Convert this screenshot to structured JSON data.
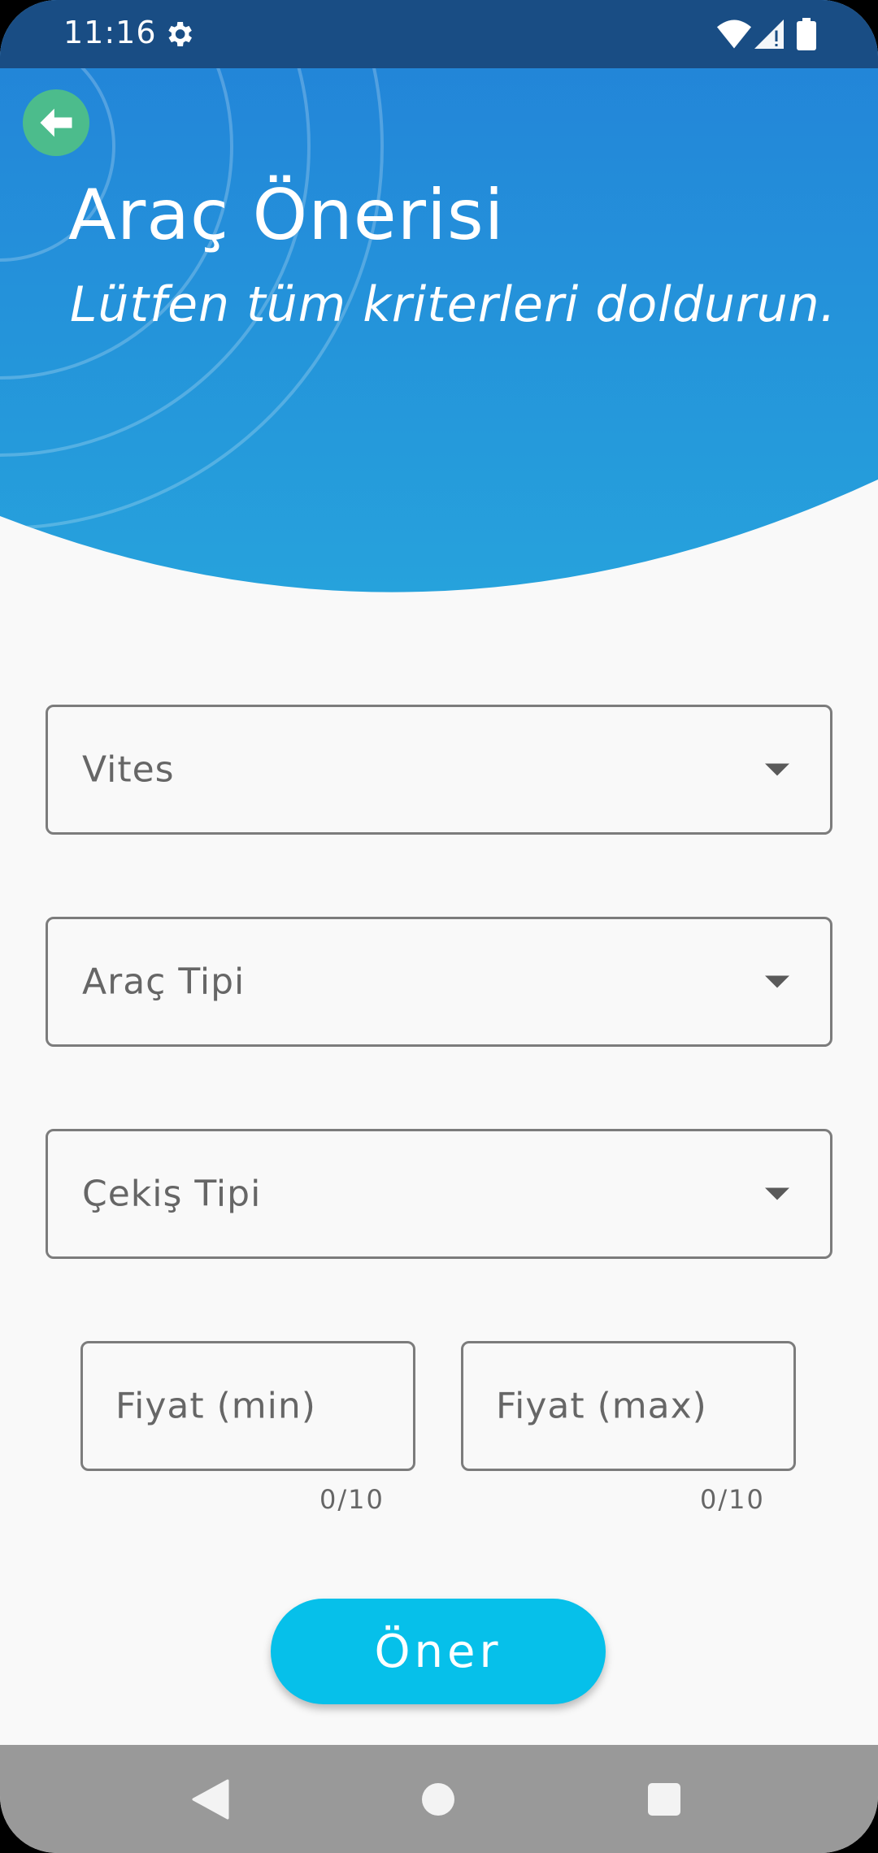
{
  "status_bar": {
    "time": "11:16",
    "icons": [
      "gear-icon",
      "wifi-icon",
      "signal-icon",
      "battery-icon"
    ]
  },
  "header": {
    "back_icon": "arrow-left-icon",
    "title": "Araç Önerisi",
    "subtitle": "Lütfen tüm kriterleri doldurun.",
    "colors": {
      "top": "#2282d8",
      "bottom": "#26a2dc",
      "back_button": "#4cbc8c"
    }
  },
  "form": {
    "gear_dropdown": {
      "label": "Vites"
    },
    "vehicle_type_dropdown": {
      "label": "Araç Tipi"
    },
    "drive_type_dropdown": {
      "label": "Çekiş Tipi"
    },
    "price_min": {
      "placeholder": "Fiyat (min)",
      "counter": "0/10"
    },
    "price_max": {
      "placeholder": "Fiyat (max)",
      "counter": "0/10"
    },
    "submit_label": "Öner",
    "submit_color": "#06c0ea"
  },
  "nav_bar": {
    "icons": [
      "back-triangle-icon",
      "home-circle-icon",
      "recents-square-icon"
    ]
  }
}
